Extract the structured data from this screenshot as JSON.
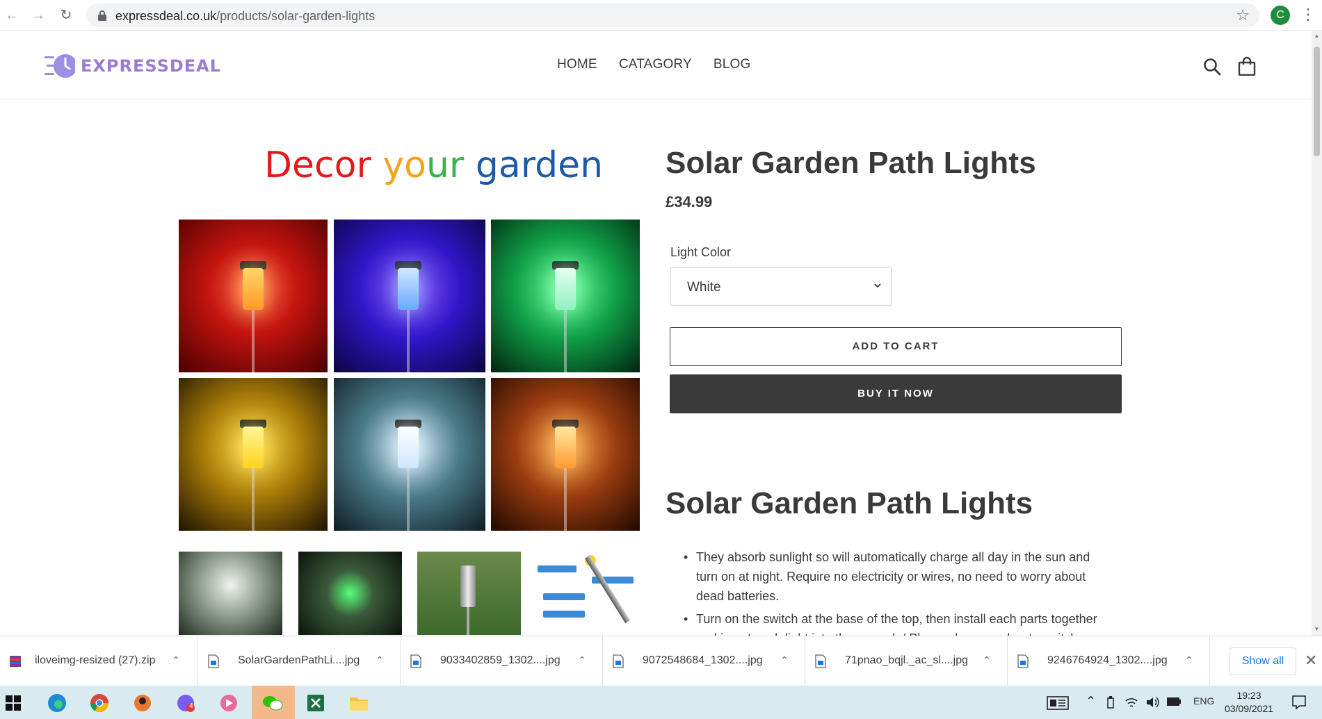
{
  "browser": {
    "url_domain": "expressdeal.co.uk",
    "url_path": "/products/solar-garden-lights",
    "profile_initial": "C"
  },
  "header": {
    "logo_text": "EXPRESSDEAL",
    "nav": [
      "HOME",
      "CATAGORY",
      "BLOG"
    ]
  },
  "product": {
    "banner": {
      "w1": "Decor ",
      "w2a": "yo",
      "w2b": "ur ",
      "w3": "garden"
    },
    "title": "Solar Garden Path Lights",
    "price": "£34.99",
    "option_label": "Light Color",
    "option_value": "White",
    "add_to_cart": "ADD TO CART",
    "buy_now": "BUY IT NOW",
    "description_title": "Solar Garden Path Lights",
    "description": [
      "They absorb sunlight so will automatically charge all day in the sun and turn on at night. Require no electricity or wires, no need to worry about dead batteries.",
      "Turn on the switch at the base of the top, then install each parts together and insert each light into the ground. / Please do remember to switch"
    ]
  },
  "downloads": {
    "items": [
      "iloveimg-resized (27).zip",
      "SolarGardenPathLi....jpg",
      "9033402859_1302....jpg",
      "9072548684_1302....jpg",
      "71pnao_bqjl._ac_sl....jpg",
      "9246764924_1302....jpg"
    ],
    "show_all": "Show all"
  },
  "taskbar": {
    "lang": "ENG",
    "time": "19:23",
    "date": "03/09/2021",
    "chat_badge": "4"
  },
  "colors": {
    "text": "#3a3a3a",
    "logo": "#9c7bd3",
    "buy_now_bg": "#3a3a3a",
    "link_blue": "#1a73e8",
    "taskbar_bg": "#d9ebf0"
  }
}
